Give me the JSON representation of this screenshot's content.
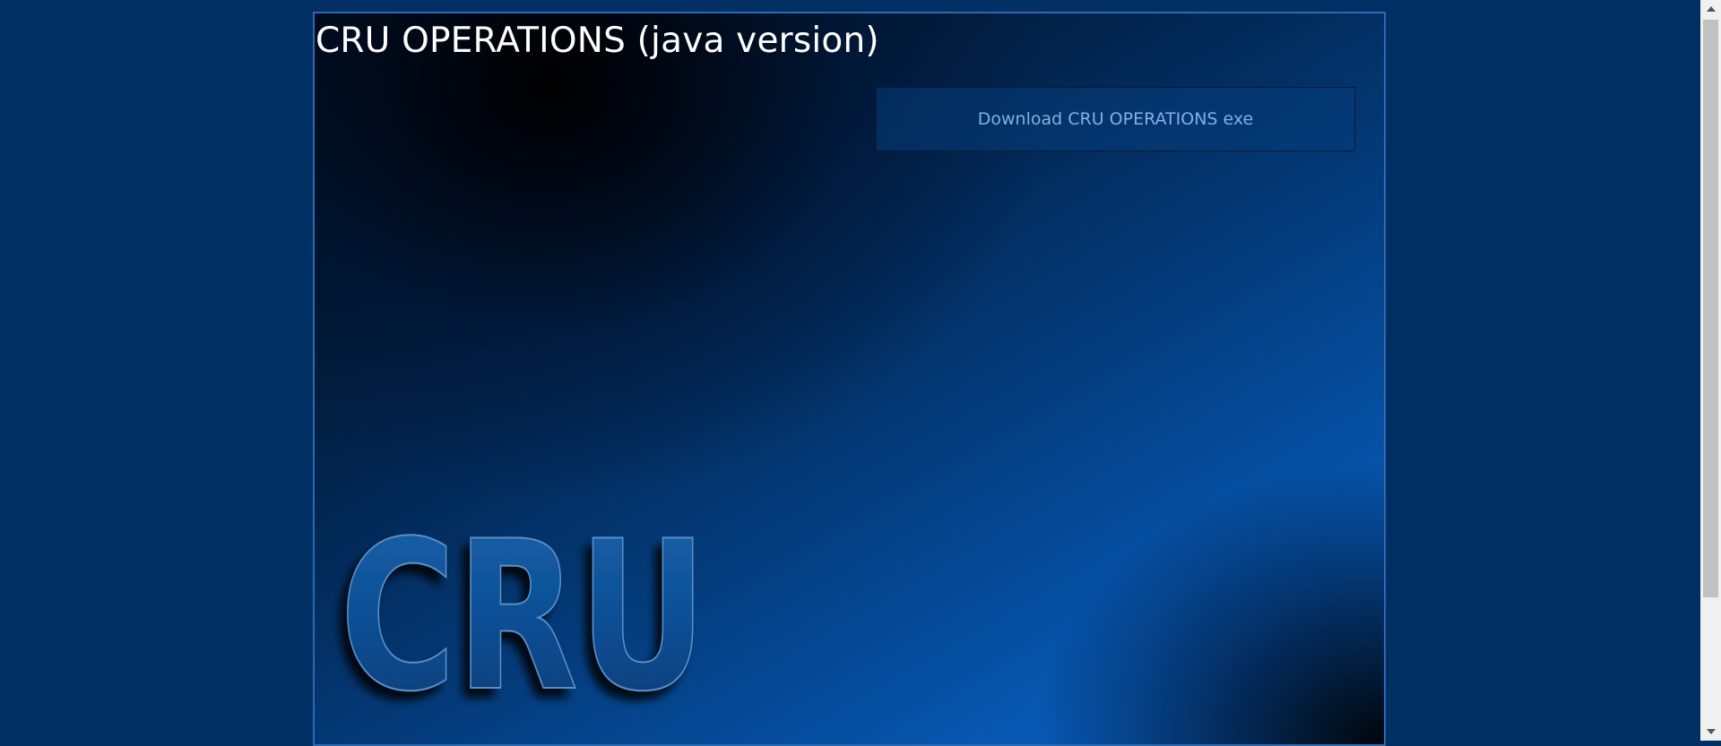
{
  "page": {
    "title": "CRU OPERATIONS (java version)",
    "download_label": "Download CRU OPERATIONS exe"
  },
  "logo": {
    "text": "CRU"
  },
  "colors": {
    "page_background": "#002f63",
    "title_text": "#ffffff",
    "button_text": "#7fb1e6",
    "logo_blue": "#0c4f95"
  },
  "scrollbar": {
    "up_icon": "scroll-up-arrow",
    "down_icon": "scroll-down-arrow"
  }
}
